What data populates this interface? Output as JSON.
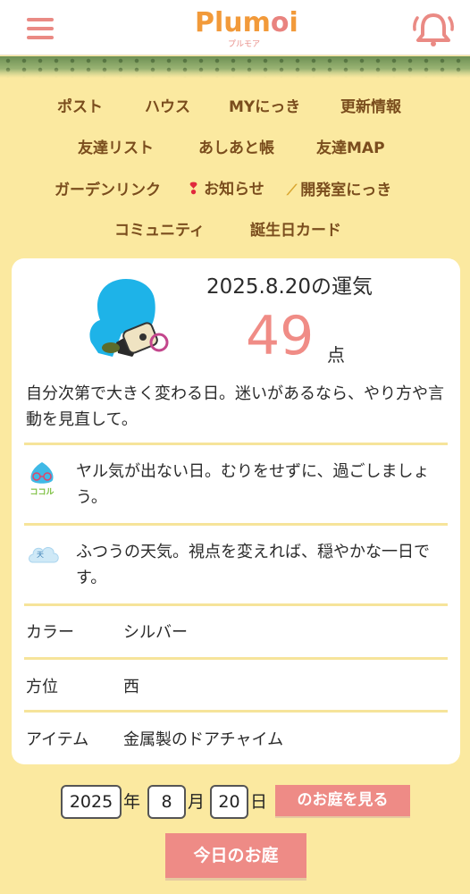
{
  "header": {
    "logo_text": "Plumoi",
    "logo_kana": "プルモア",
    "menu_icon": "hamburger-menu-icon",
    "bell_icon": "bell-icon"
  },
  "nav": {
    "items": [
      "ポスト",
      "ハウス",
      "MYにっき",
      "更新情報",
      "友達リスト",
      "あしあと帳",
      "友達MAP",
      "ガーデンリンク",
      "お知らせ",
      "開発室にっき",
      "コミュニティ",
      "誕生日カード"
    ]
  },
  "fortune": {
    "date": "2025.8.20の運気",
    "score": "49",
    "unit": "点",
    "text": "自分次第で大きく変わる日。迷いがあるなら、やり方や言動を見直して。",
    "kokoro_icon_label": "ココル",
    "kokoro_text": "ヤル気が出ない日。むりをせずに、過ごしましょう。",
    "weather_icon_label": "天",
    "weather_text": "ふつうの天気。視点を変えれば、穏やかな一日です。",
    "color_label": "カラー",
    "color_value": "シルバー",
    "direction_label": "方位",
    "direction_value": "西",
    "item_label": "アイテム",
    "item_value": "金属製のドアチャイム"
  },
  "date_select": {
    "year": "2025",
    "year_label": "年",
    "month": "8",
    "month_label": "月",
    "day": "20",
    "day_label": "日"
  },
  "buttons": {
    "view_garden": "のお庭を見る",
    "today_garden": "今日のお庭"
  },
  "colors": {
    "background": "#fbe9a0",
    "accent_pink": "#ee8b86",
    "nav_brown": "#7a4d1d",
    "score_pink": "#f08c86"
  }
}
